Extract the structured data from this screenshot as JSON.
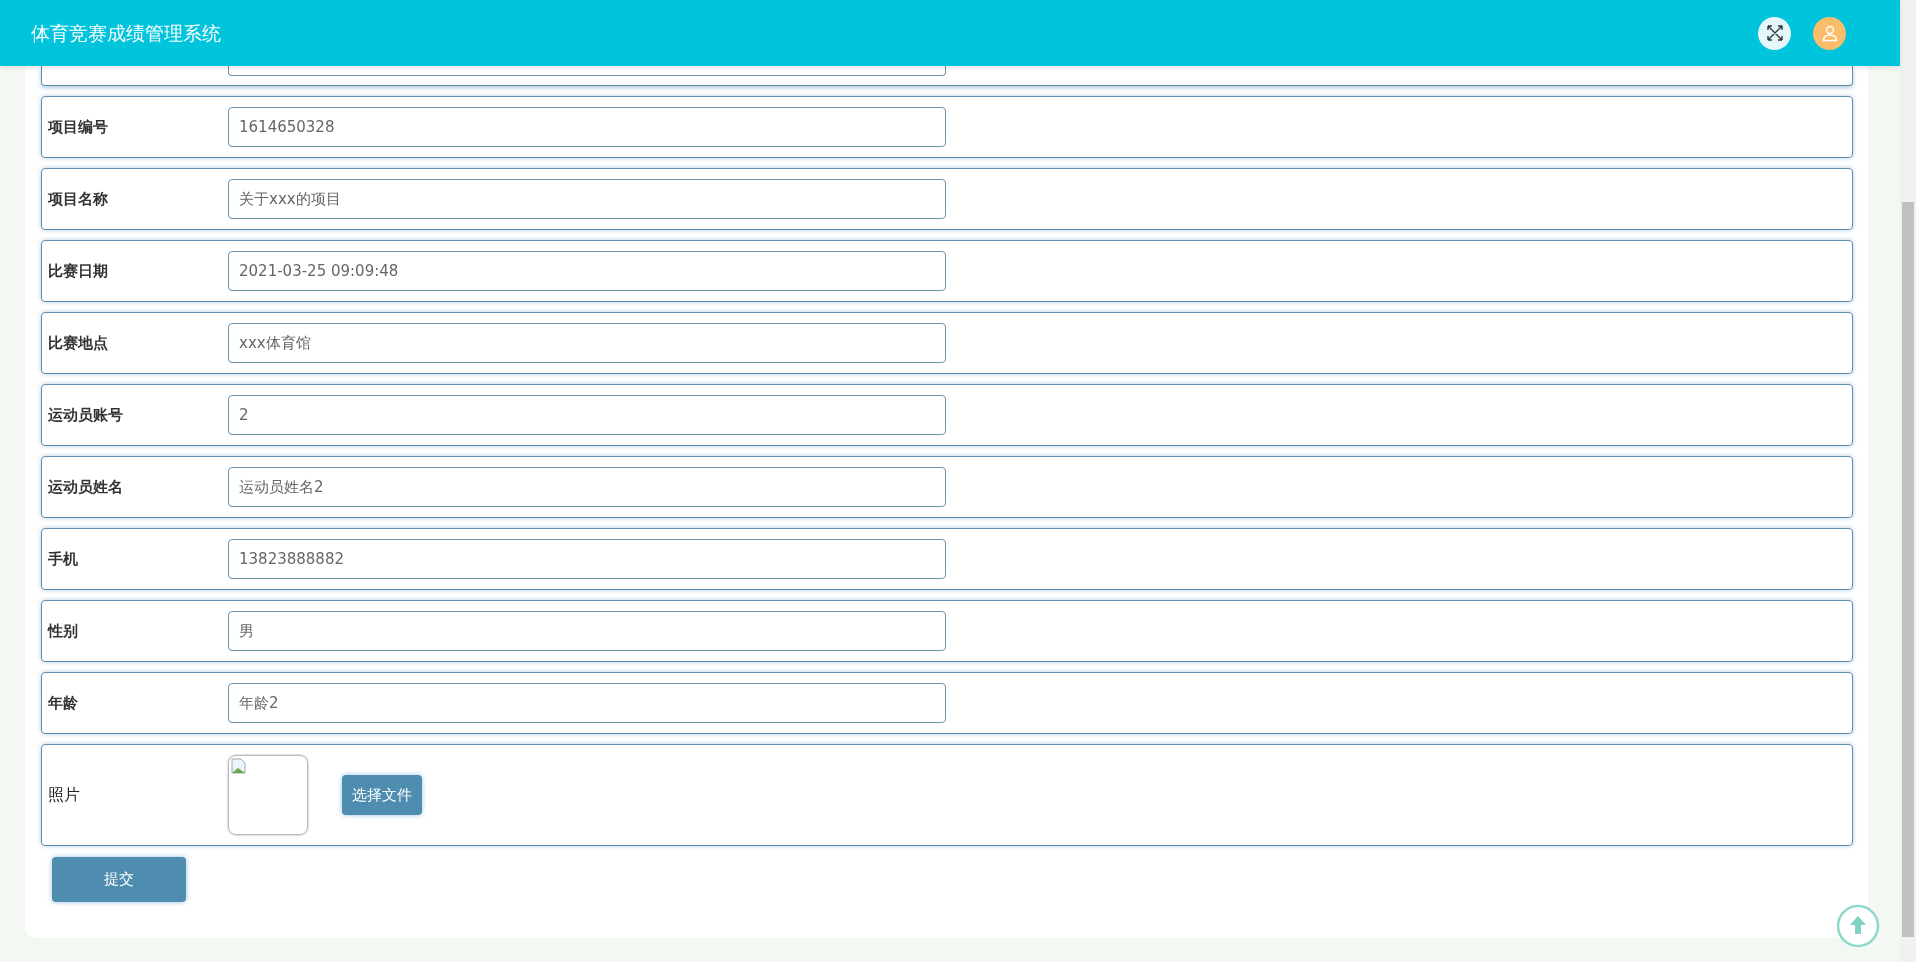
{
  "header": {
    "title": "体育竞赛成绩管理系统"
  },
  "form": {
    "fields": [
      {
        "label": "项目编号",
        "value": "1614650328"
      },
      {
        "label": "项目名称",
        "value": "关于xxx的项目"
      },
      {
        "label": "比赛日期",
        "value": "2021-03-25 09:09:48"
      },
      {
        "label": "比赛地点",
        "value": "xxx体育馆"
      },
      {
        "label": "运动员账号",
        "value": "2"
      },
      {
        "label": "运动员姓名",
        "value": "运动员姓名2"
      },
      {
        "label": "手机",
        "value": "13823888882"
      },
      {
        "label": "性别",
        "value": "男"
      },
      {
        "label": "年龄",
        "value": "年龄2"
      }
    ],
    "photo": {
      "label": "照片",
      "button": "选择文件"
    },
    "submit": "提交"
  }
}
